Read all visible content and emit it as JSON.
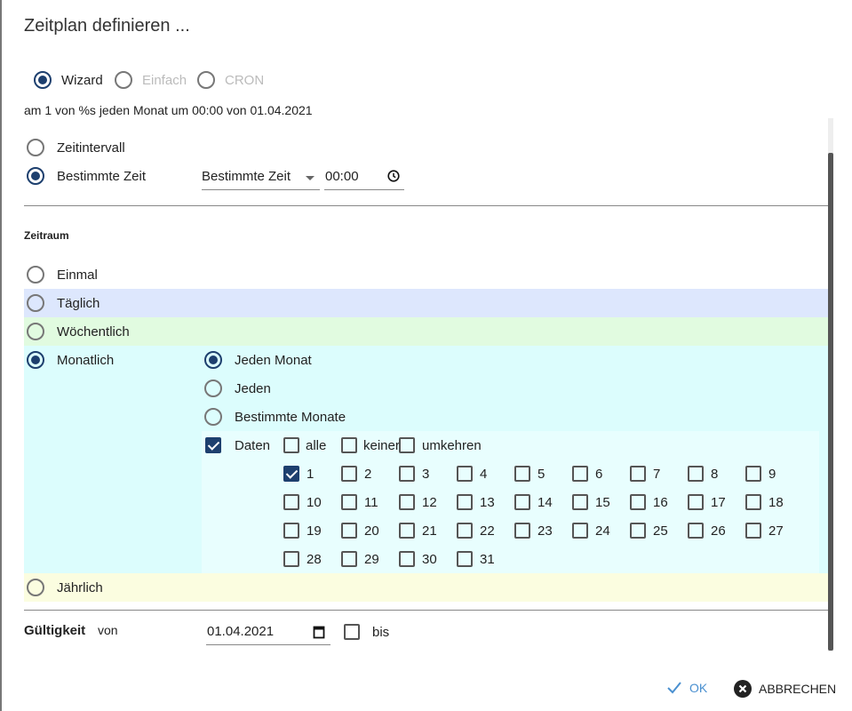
{
  "title": "Zeitplan definieren ...",
  "mode": {
    "options": [
      {
        "label": "Wizard",
        "selected": true,
        "disabled": false
      },
      {
        "label": "Einfach",
        "selected": false,
        "disabled": true
      },
      {
        "label": "CRON",
        "selected": false,
        "disabled": true
      }
    ]
  },
  "summary": "am 1 von %s jeden Monat um 00:00 von 01.04.2021",
  "time_type": {
    "options": [
      {
        "label": "Zeitintervall",
        "selected": false
      },
      {
        "label": "Bestimmte Zeit",
        "selected": true
      }
    ],
    "select_value": "Bestimmte Zeit",
    "time_value": "00:00"
  },
  "period": {
    "heading": "Zeitraum",
    "options": [
      {
        "label": "Einmal",
        "selected": false,
        "color": "#ffffff"
      },
      {
        "label": "Täglich",
        "selected": false,
        "color": "#dde7fd"
      },
      {
        "label": "Wöchentlich",
        "selected": false,
        "color": "#e1fbe0"
      },
      {
        "label": "Monatlich",
        "selected": true,
        "color": "#dcfdfd"
      },
      {
        "label": "Jährlich",
        "selected": false,
        "color": "#fbfde0"
      }
    ]
  },
  "monthly": {
    "options": [
      {
        "label": "Jeden Monat",
        "selected": true
      },
      {
        "label": "Jeden",
        "selected": false
      },
      {
        "label": "Bestimmte Monate",
        "selected": false
      }
    ],
    "dates_label": "Daten",
    "dates_checked": true,
    "all_label": "alle",
    "none_label": "keiner",
    "invert_label": "umkehren",
    "days": [
      1,
      2,
      3,
      4,
      5,
      6,
      7,
      8,
      9,
      10,
      11,
      12,
      13,
      14,
      15,
      16,
      17,
      18,
      19,
      20,
      21,
      22,
      23,
      24,
      25,
      26,
      27,
      28,
      29,
      30,
      31
    ],
    "selected_days": [
      1
    ]
  },
  "validity": {
    "label": "Gültigkeit",
    "from_label": "von",
    "from_value": "01.04.2021",
    "until_label": "bis",
    "until_checked": false
  },
  "buttons": {
    "ok": "OK",
    "cancel": "ABBRECHEN"
  },
  "colors": {
    "accent": "#1d3f6e",
    "ok": "#4a90d0"
  }
}
